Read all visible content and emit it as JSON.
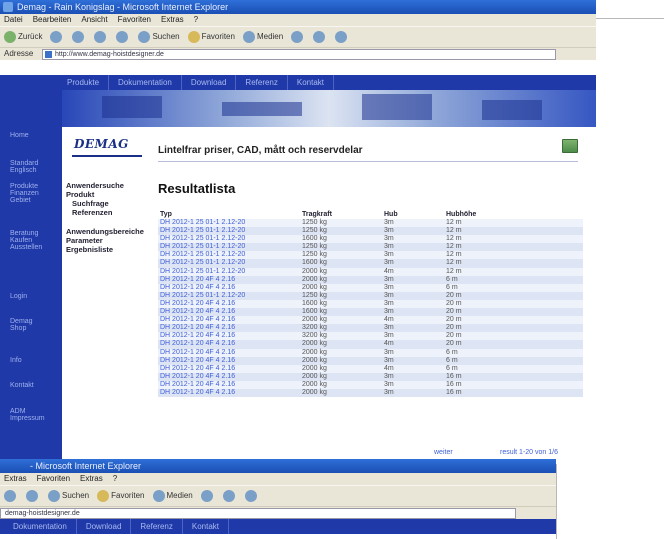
{
  "back_window": {
    "title": "Demag - Rain Konigslag - Microsoft Internet Explorer",
    "menu": [
      "Datei",
      "Bearbeiten",
      "Ansicht",
      "Favoriten",
      "Extras",
      "?"
    ],
    "toolbar": {
      "back": "Zurück",
      "forward": "",
      "search": "Suchen",
      "favorites": "Favoriten",
      "media": "Medien"
    },
    "address_label": "Adresse",
    "address_url": "http://www.demag-hoistdesigner.de",
    "site_nav": [
      "Produkte",
      "Dokumentation",
      "Download",
      "Referenz",
      "Kontakt"
    ],
    "left_nav": [
      "Home",
      "Standard Englisch",
      "Produkte Finanzen Gebiet",
      "Beratung Kaufen Ausstellen",
      "Login",
      "Demag Shop",
      "Info",
      "Kontakt",
      "ADM Impressum"
    ],
    "logo": "DEMAG",
    "page_title": "Lintelfrar priser, CAD, mått och reservdelar",
    "sub_nav": [
      "Anwendersuche",
      "Produkt",
      "Suchfrage",
      "Referenzen",
      "Anwendungsbereiche",
      "Parameter",
      "Ergebnisliste"
    ],
    "heading": "Resultatlista",
    "table": {
      "headers": [
        "Typ",
        "Tragkraft",
        "Hub",
        "Hubhöhe"
      ],
      "rows": [
        [
          "DH 2012-1 25 01-1 2.12-20",
          "1250 kg",
          "3m",
          "12 m"
        ],
        [
          "DH 2012-1 25 01-1 2.12-20",
          "1250 kg",
          "3m",
          "12 m"
        ],
        [
          "DH 2012-1 25 01-1 2.12-20",
          "1600 kg",
          "3m",
          "12 m"
        ],
        [
          "DH 2012-1 25 01-1 2.12-20",
          "1250 kg",
          "3m",
          "12 m"
        ],
        [
          "DH 2012-1 25 01-1 2.12-20",
          "1250 kg",
          "3m",
          "12 m"
        ],
        [
          "DH 2012-1 25 01-1 2.12-20",
          "1600 kg",
          "3m",
          "12 m"
        ],
        [
          "DH 2012-1 25 01-1 2.12-20",
          "2000 kg",
          "4m",
          "12 m"
        ],
        [
          "DH 2012-1 20 4F 4 2.16",
          "2000 kg",
          "3m",
          "6 m"
        ],
        [
          "DH 2012-1 20 4F 4 2.16",
          "2000 kg",
          "3m",
          "6 m"
        ],
        [
          "DH 2012-1 25 01-1 2.12-20",
          "1250 kg",
          "3m",
          "20 m"
        ],
        [
          "DH 2012-1 20 4F 4 2.16",
          "1600 kg",
          "3m",
          "20 m"
        ],
        [
          "DH 2012-1 20 4F 4 2.16",
          "1600 kg",
          "3m",
          "20 m"
        ],
        [
          "DH 2012-1 20 4F 4 2.16",
          "2000 kg",
          "4m",
          "20 m"
        ],
        [
          "DH 2012-1 20 4F 4 2.16",
          "3200 kg",
          "3m",
          "20 m"
        ],
        [
          "DH 2012-1 20 4F 4 2.16",
          "3200 kg",
          "3m",
          "20 m"
        ],
        [
          "DH 2012-1 20 4F 4 2.16",
          "2000 kg",
          "4m",
          "20 m"
        ],
        [
          "DH 2012-1 20 4F 4 2.16",
          "2000 kg",
          "3m",
          "6 m"
        ],
        [
          "DH 2012-1 20 4F 4 2.16",
          "2000 kg",
          "3m",
          "6 m"
        ],
        [
          "DH 2012-1 20 4F 4 2.16",
          "2000 kg",
          "4m",
          "6 m"
        ],
        [
          "DH 2012-1 20 4F 4 2.16",
          "2000 kg",
          "3m",
          "16 m"
        ],
        [
          "DH 2012-1 20 4F 4 2.16",
          "2000 kg",
          "3m",
          "16 m"
        ],
        [
          "DH 2012-1 20 4F 4 2.16",
          "2000 kg",
          "3m",
          "16 m"
        ]
      ]
    },
    "bottom_link": "weiter",
    "bottom_pager": "result 1-20 von 1/6"
  },
  "front_window": {
    "title": "- Microsoft Internet Explorer",
    "menu": [
      "Extras",
      "Favoriten",
      "Extras",
      "?"
    ],
    "toolbar": {
      "search": "Suchen",
      "favorites": "Favoriten",
      "media": "Medien"
    },
    "address_url": "demag-hoistdesigner.de",
    "site_nav": [
      "Dokumentation",
      "Download",
      "Referenz",
      "Kontakt"
    ]
  },
  "colors": {
    "site_blue": "#1f3aa8",
    "link_blue": "#3f5fd8",
    "row_alt": "#dde4f3",
    "titlebar": "#2e6fd8"
  }
}
